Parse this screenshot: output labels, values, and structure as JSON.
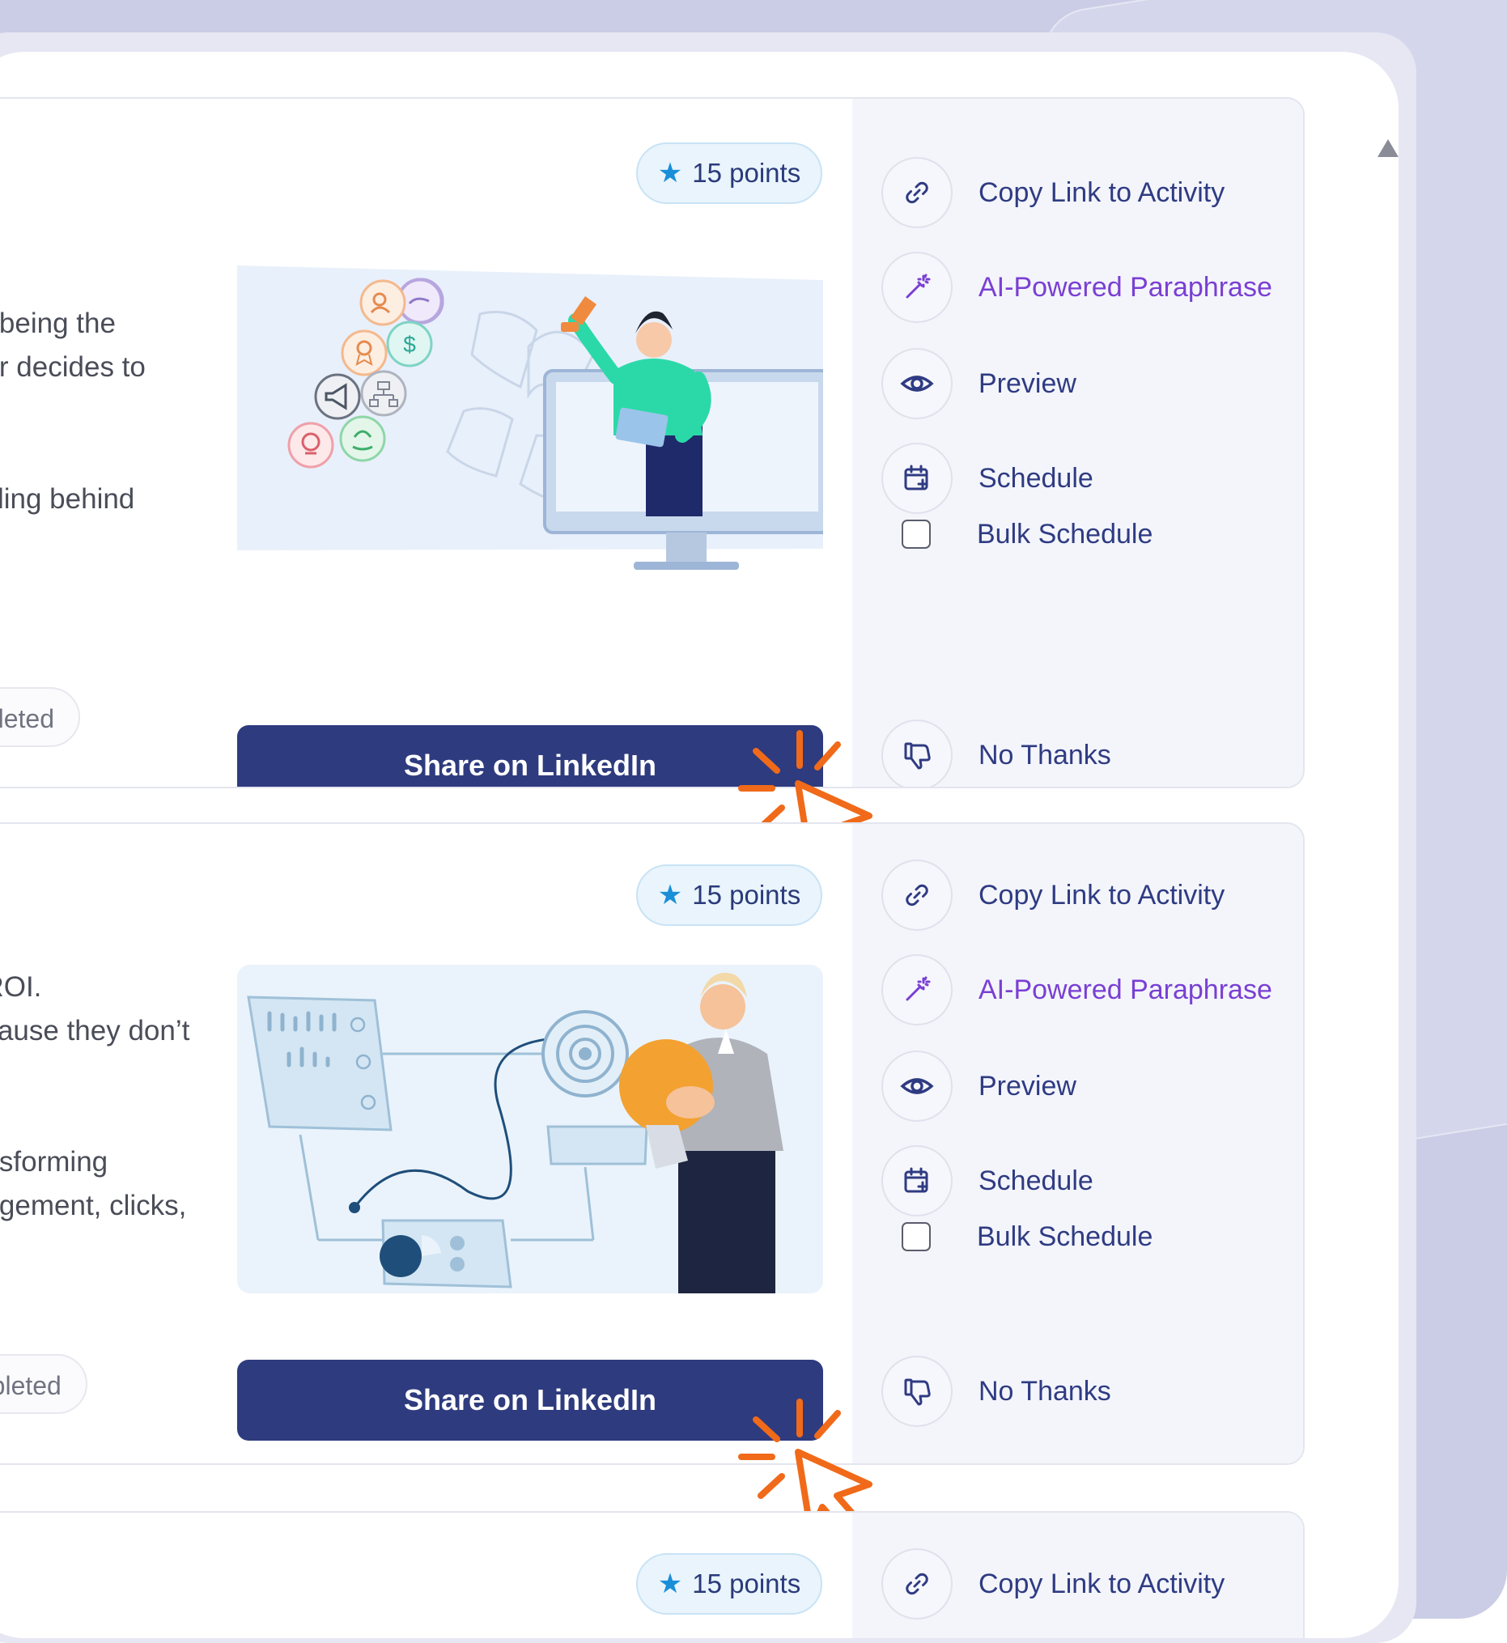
{
  "cards": [
    {
      "points_label": "15 points",
      "description_lines": [
        "ut being the",
        "ner decides to",
        "falling behind"
      ],
      "status_label": "npleted",
      "share_label": "Share on LinkedIn",
      "illustration": "marketing-icons-magnet-presenter-illustration"
    },
    {
      "points_label": "15 points",
      "description_lines": [
        "t ROI.",
        "ecause they don’t",
        "ansforming",
        "gagement, clicks,"
      ],
      "status_label": "mpleted",
      "share_label": "Share on LinkedIn",
      "illustration": "analytics-target-lightbulb-illustration"
    },
    {
      "points_label": "15 points"
    }
  ],
  "actions": {
    "copy_link": "Copy Link to Activity",
    "ai_paraphrase": "AI-Powered Paraphrase",
    "preview": "Preview",
    "schedule": "Schedule",
    "bulk_schedule": "Bulk Schedule",
    "no_thanks": "No Thanks"
  },
  "icons": {
    "copy_link": "link-icon",
    "ai_paraphrase": "magic-wand-icon",
    "preview": "eye-icon",
    "schedule": "calendar-add-icon",
    "no_thanks": "thumbs-down-icon",
    "points": "star-icon",
    "click": "cursor-click-icon"
  },
  "colors": {
    "primary_button": "#2e3b7e",
    "action_text": "#2f3b82",
    "ai_text": "#7a3fd3",
    "points_bg": "#e9f4fc",
    "star": "#1a8fd8",
    "click_accent": "#f06a1a",
    "panel_bg": "#f3f5fb",
    "backdrop": "#cbcde6"
  }
}
